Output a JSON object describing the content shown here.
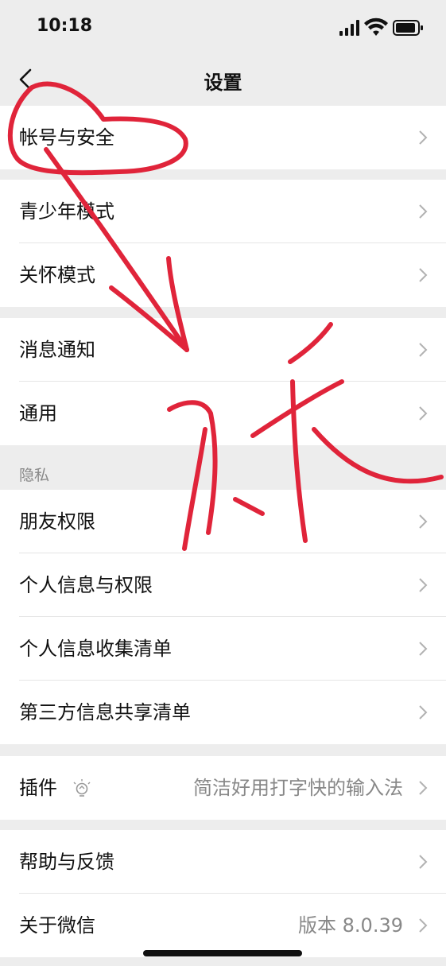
{
  "status": {
    "time": "10:18"
  },
  "nav": {
    "title": "设置"
  },
  "groups": {
    "account": {
      "label": "帐号与安全"
    },
    "teen": {
      "label": "青少年模式"
    },
    "care": {
      "label": "关怀模式"
    },
    "notify": {
      "label": "消息通知"
    },
    "general": {
      "label": "通用"
    },
    "privacy_header": "隐私",
    "friends_perm": {
      "label": "朋友权限"
    },
    "personal_info_perm": {
      "label": "个人信息与权限"
    },
    "info_collect": {
      "label": "个人信息收集清单"
    },
    "third_party": {
      "label": "第三方信息共享清单"
    },
    "plugins": {
      "label": "插件",
      "value": "简洁好用打字快的输入法"
    },
    "help": {
      "label": "帮助与反馈"
    },
    "about": {
      "label": "关于微信",
      "value": "版本 8.0.39"
    }
  },
  "colors": {
    "background": "#ededed",
    "annotation": "#e0243a"
  }
}
